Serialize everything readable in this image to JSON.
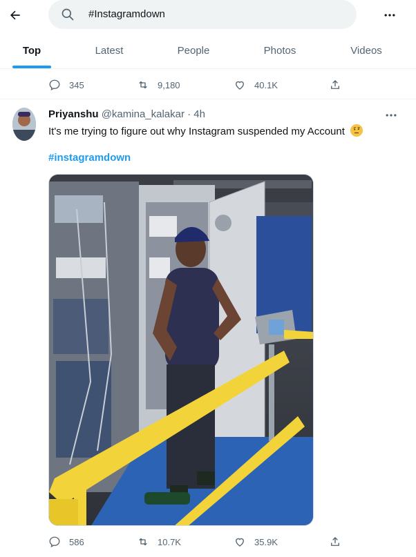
{
  "search": {
    "query": "#Instagramdown"
  },
  "tabs": [
    {
      "label": "Top"
    },
    {
      "label": "Latest"
    },
    {
      "label": "People"
    },
    {
      "label": "Photos"
    },
    {
      "label": "Videos"
    }
  ],
  "previous_tweet": {
    "replies": "345",
    "retweets": "9,180",
    "likes": "40.1K"
  },
  "tweet": {
    "display_name": "Priyanshu",
    "handle_time": "@kamina_kalakar · 4h",
    "text": "It's me trying to figure out why Instagram suspended my Account",
    "hashtag": "#instagramdown",
    "replies": "586",
    "retweets": "10.7K",
    "likes": "35.9K"
  },
  "colors": {
    "accent": "#1d9bf0",
    "muted": "#536471",
    "text": "#0f1419"
  }
}
